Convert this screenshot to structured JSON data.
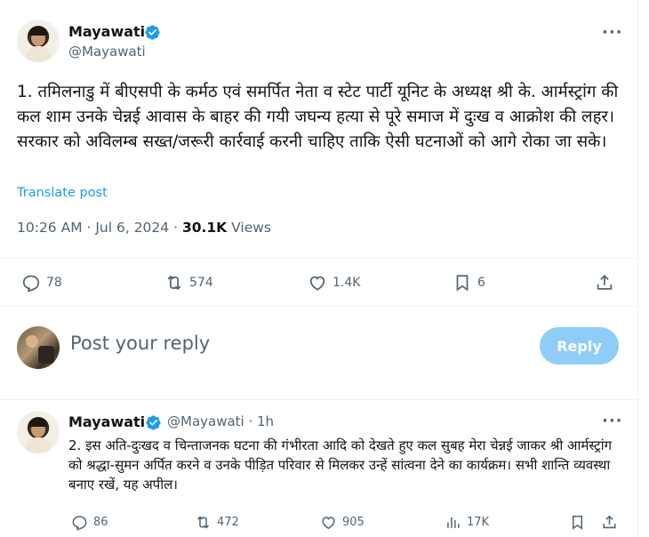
{
  "tweet": {
    "author_name": "Mayawati",
    "author_handle": "@Mayawati",
    "more": "···",
    "text": "1. तमिलनाडु में बीएसपी के कर्मठ एवं समर्पित नेता व स्टेट पार्टी यूनिट के अध्यक्ष श्री के. आर्मस्ट्रांग की कल शाम उनके चेन्नई आवास के बाहर की गयी जघन्य हत्या से पूरे समाज में दुःख व आक्रोश की लहर। सरकार को अविलम्ब सख्त/जरूरी कार्रवाई करनी चाहिए ताकि ऐसी घटनाओं को आगे रोका जा सके।",
    "translate": "Translate post",
    "time": "10:26 AM · Jul 6, 2024 · ",
    "views_count": "30.1K",
    "views_label": " Views",
    "stats": {
      "replies": "78",
      "reposts": "574",
      "likes": "1.4K",
      "bookmarks": "6"
    }
  },
  "reply_composer": {
    "placeholder": "Post your reply",
    "button": "Reply"
  },
  "reply_tweet": {
    "author_name": "Mayawati",
    "author_handle": "@Mayawati · 1h",
    "more": "···",
    "text": "2. इस अति-दुःखद व चिन्ताजनक घटना की गंभीरता आदि को देखते हुए कल सुबह मेरा चेन्नई जाकर श्री आर्मस्ट्रांग को श्रद्धा-सुमन अर्पित करने व उनके पीड़ित परिवार से मिलकर उन्हें सांत्वना देने का कार्यक्रम। सभी शान्ति व्यवस्था बनाए रखें, यह अपील।",
    "stats": {
      "replies": "86",
      "reposts": "472",
      "likes": "905",
      "views": "17K"
    }
  },
  "colors": {
    "verified": "#1d9bf0",
    "link": "#1d9bf0",
    "reply_button": "#8ecdf8",
    "muted": "#536471"
  },
  "icons": [
    "verified-badge-icon",
    "more-icon",
    "reply-icon",
    "repost-icon",
    "like-icon",
    "bookmark-icon",
    "share-icon",
    "views-icon"
  ]
}
